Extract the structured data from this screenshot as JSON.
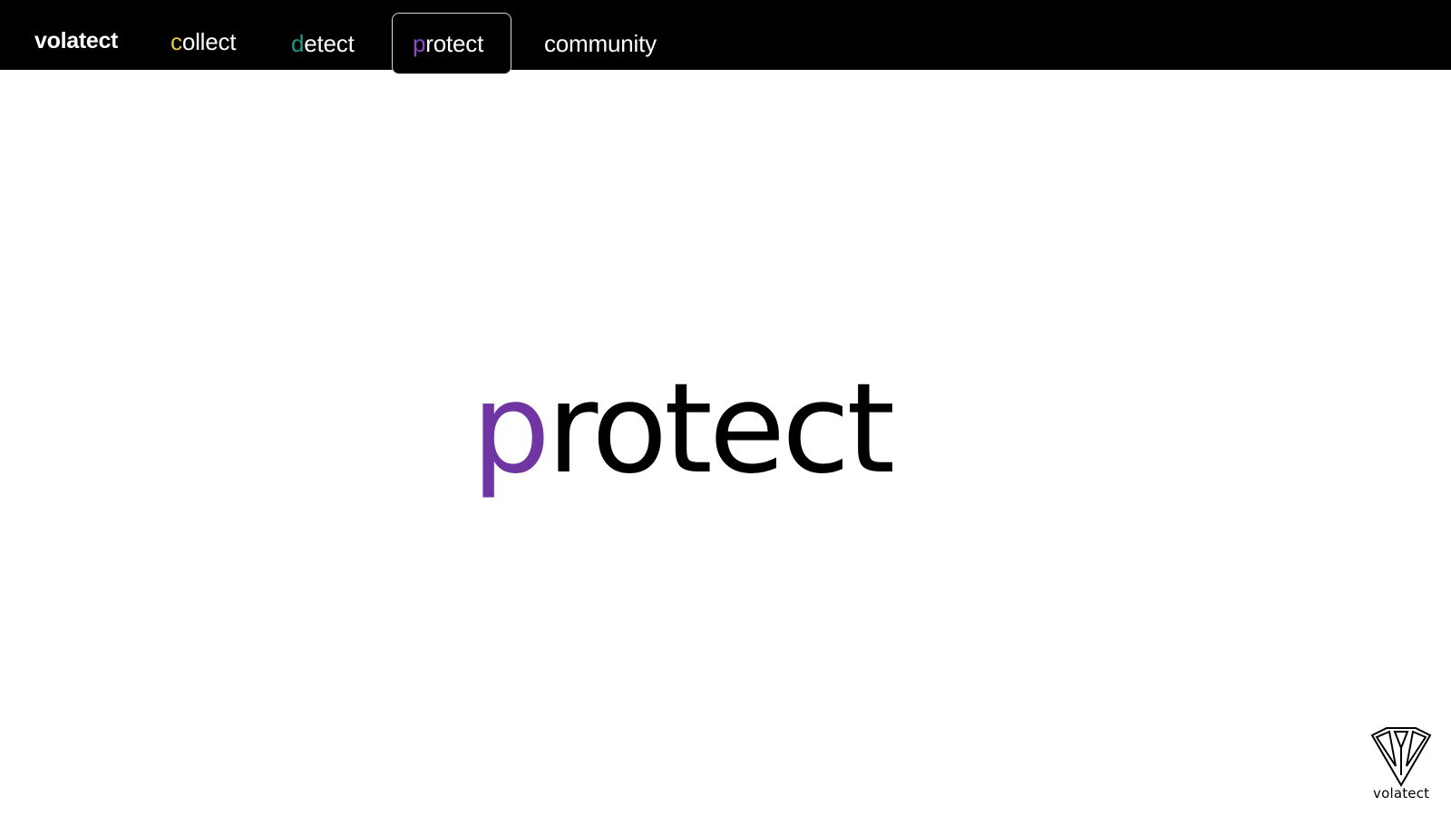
{
  "app": {
    "brand": "volatect"
  },
  "nav": {
    "items": [
      {
        "initial": "c",
        "rest": "ollect",
        "accent": "#e7c64d"
      },
      {
        "initial": "d",
        "rest": "etect",
        "accent": "#1e9a8b"
      },
      {
        "initial": "p",
        "rest": "rotect",
        "accent": "#8b49c8",
        "active": true
      },
      {
        "initial": "",
        "rest": "community",
        "accent": "#ffffff"
      }
    ]
  },
  "hero": {
    "initial": "p",
    "rest": "rotect",
    "accent": "#6f35a3"
  },
  "footer": {
    "logo_text": "volatect",
    "icon": "shield-triangle-logo-icon"
  }
}
